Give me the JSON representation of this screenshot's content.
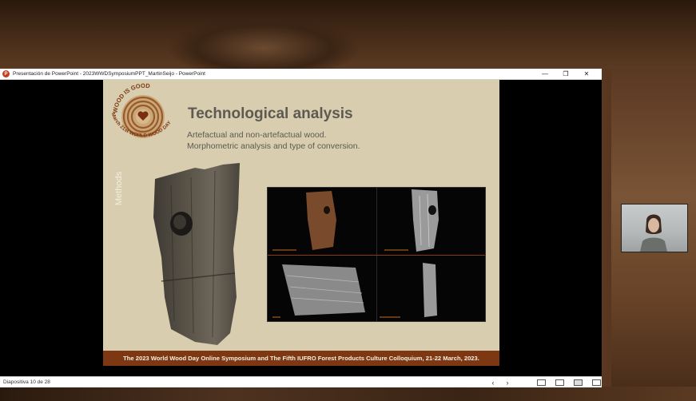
{
  "window": {
    "title": "Presentación de PowerPoint  -  2023WWDSymposiumPPT_MartinSeijo - PowerPoint",
    "app_icon": "P",
    "controls": {
      "minimize": "—",
      "restore": "❐",
      "close": "✕"
    }
  },
  "slide": {
    "logo_text_top": "WOOD IS GOOD",
    "logo_text_bottom": "March 21st WORLD WOOD DAY",
    "title": "Technological analysis",
    "subtitle_line1": "Artefactual and non-artefactual wood.",
    "subtitle_line2": "Morphometric analysis and type of conversion.",
    "side_label": "Methods",
    "footer": "The 2023 World Wood Day Online Symposium and The Fifth IUFRO Forest Products Culture Colloquium, 21-22 March, 2023."
  },
  "statusbar": {
    "slide_counter": "Diapositiva 10 de 28",
    "prev_icon": "chevron-left-icon",
    "next_icon": "chevron-right-icon",
    "prev_glyph": "‹",
    "next_glyph": "›"
  },
  "colors": {
    "slide_bg": "#d8cdae",
    "footer_bg": "#7d3813",
    "title_color": "#5d5a52"
  }
}
